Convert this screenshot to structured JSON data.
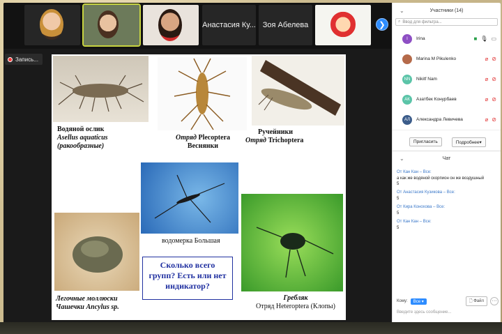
{
  "gallery": {
    "tiles": [
      {
        "label": ""
      },
      {
        "label": ""
      },
      {
        "label": ""
      },
      {
        "label": "Анастасия Ку..."
      },
      {
        "label": "Зоя Абелева"
      },
      {
        "label": ""
      }
    ],
    "next_glyph": "❯"
  },
  "recording": {
    "label": "Запись..."
  },
  "slide": {
    "asellus": {
      "line1": "Водяной ослик",
      "line2": "Asellus aquaticus",
      "line3": "(ракообразные)"
    },
    "plecoptera": {
      "line1a": "Отряд",
      "line1b": " Plecoptera",
      "line2": "Веснянки"
    },
    "trichoptera": {
      "line1": "Ручейники",
      "line2a": "Отряд",
      "line2b": " Trichoptera"
    },
    "gerris": {
      "line1": "водомерка Большая"
    },
    "question": {
      "line1": "Сколько всего",
      "line2": "групп? Есть или нет",
      "line3": "индикатор?"
    },
    "mollusc": {
      "line1": "Легочные моллюски",
      "line2": "Чашечки Ancylus sp."
    },
    "hemiptera": {
      "line1": "Гребляк",
      "line2": "Отряд Heteroptera (Клопы)"
    }
  },
  "participants": {
    "title": "Участники (14)",
    "filter_placeholder": "Ввод для фильтра...",
    "items": [
      {
        "name": "Irina",
        "avatar_color": "#8e4fc4",
        "initials": "I"
      },
      {
        "name": "Marina M Pikulenko",
        "avatar_color": "#b56a4a",
        "initials": ""
      },
      {
        "name": "Nikitf Nam",
        "avatar_color": "#5bc4a8",
        "initials": "NN"
      },
      {
        "name": "Азатбек Конурбаев",
        "avatar_color": "#5bc4a8",
        "initials": "АК"
      },
      {
        "name": "Александра Левичева",
        "avatar_color": "#3b5c8a",
        "initials": "АЛ"
      }
    ],
    "invite_label": "Пригласить",
    "more_label": "Подробнее▾"
  },
  "chat": {
    "title": "Чат",
    "messages": [
      {
        "from": "От Кан Кан – Все:",
        "text": "а как же водяной скорпион он же воздушный",
        "text2": "5"
      },
      {
        "from": "От Анастасия Кузикова – Все:",
        "text": "5"
      },
      {
        "from": "От Кира Конохова – Все:",
        "text": "5"
      },
      {
        "from": "От Кан Кан – Все:",
        "text": "5"
      }
    ],
    "to_label": "Кому:",
    "to_value": "Все ▾",
    "file_label": "Файл",
    "more_glyph": "···",
    "input_placeholder": "Введите здесь сообщение..."
  },
  "colors": {
    "accent": "#2d8cff",
    "recording": "#ff3b3b"
  }
}
